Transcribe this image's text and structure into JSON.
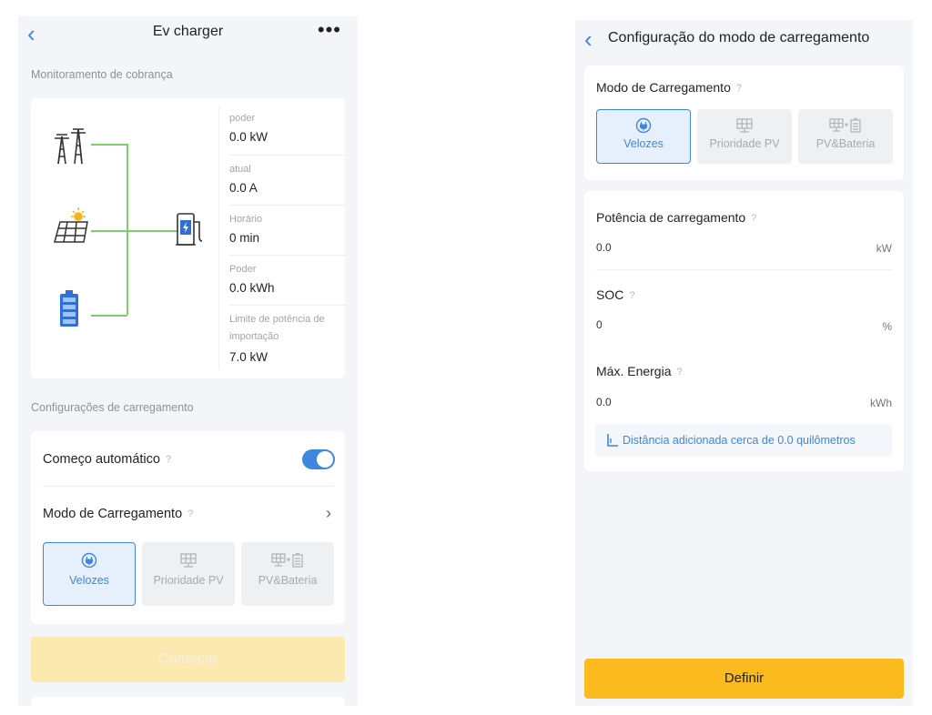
{
  "left": {
    "nav": {
      "title": "Ev charger",
      "more": "•••"
    },
    "monitor_section": "Monitoramento de cobrança",
    "metrics": [
      {
        "label": "poder",
        "value": "0.0 kW"
      },
      {
        "label": "atual",
        "value": "0.0 A"
      },
      {
        "label": "Horário",
        "value": "0 min"
      },
      {
        "label": "Poder",
        "value": "0.0 kWh"
      },
      {
        "label": "Limite de potência de importação",
        "value": "7.0 kW"
      }
    ],
    "settings_section": "Configurações de carregamento",
    "auto_start_label": "Começo automático",
    "auto_start_on": true,
    "mode_label": "Modo de Carregamento",
    "modes": [
      {
        "label": "Velozes",
        "icon": "plug-icon",
        "active": true
      },
      {
        "label": "Prioridade PV",
        "icon": "solar-panel-icon",
        "active": false
      },
      {
        "label": "PV&Bateria",
        "icon": "solar-battery-icon",
        "active": false
      }
    ],
    "start_button": "Começar"
  },
  "right": {
    "nav": {
      "title": "Configuração do modo de carregamento"
    },
    "mode_label": "Modo de Carregamento",
    "modes": [
      {
        "label": "Velozes",
        "icon": "plug-icon",
        "active": true
      },
      {
        "label": "Prioridade PV",
        "icon": "solar-panel-icon",
        "active": false
      },
      {
        "label": "PV&Bateria",
        "icon": "solar-battery-icon",
        "active": false
      }
    ],
    "fields": [
      {
        "label": "Potência de carregamento",
        "value": "0.0",
        "unit": "kW"
      },
      {
        "label": "SOC",
        "value": "0",
        "unit": "%"
      },
      {
        "label": "Máx. Energia",
        "value": "0.0",
        "unit": "kWh"
      }
    ],
    "info_text": "Distância adicionada cerca de 0.0 quilômetros",
    "define_button": "Definir"
  },
  "colors": {
    "accent": "#3f86e0",
    "flow_line": "#7ccf6b",
    "start_button": "#fbe9b0",
    "define_button": "#fbbb1f"
  }
}
